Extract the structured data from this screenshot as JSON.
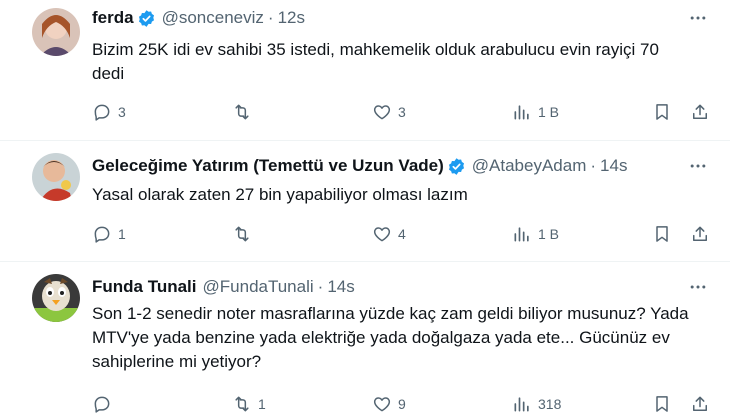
{
  "tweets": [
    {
      "name": "ferda",
      "verified": true,
      "handle": "@sonceneviz",
      "time": "12s",
      "text": "Bizim 25K idi ev sahibi 35 istedi, mahkemelik olduk arabulucu evin rayiçi 70 dedi",
      "replies": "3",
      "retweets": "",
      "likes": "3",
      "views": "1 B"
    },
    {
      "name": "Geleceğime Yatırım (Temettü ve Uzun Vade)",
      "verified": true,
      "handle": "@AtabeyAdam",
      "time": "14s",
      "text": "Yasal olarak zaten 27 bin yapabiliyor olması lazım",
      "replies": "1",
      "retweets": "",
      "likes": "4",
      "views": "1 B"
    },
    {
      "name": "Funda Tunali",
      "verified": false,
      "handle": "@FundaTunali",
      "time": "14s",
      "text": "Son 1-2 senedir noter masraflarına yüzde kaç zam geldi biliyor musunuz? Yada MTV'ye yada benzine yada elektriğe yada doğalgaza yada ete... Gücünüz ev sahiplerine mi yetiyor?",
      "replies": "",
      "retweets": "1",
      "likes": "9",
      "views": "318"
    }
  ],
  "colors": {
    "verified": "#1d9bf0",
    "muted": "#536471",
    "text": "#0f1419"
  }
}
